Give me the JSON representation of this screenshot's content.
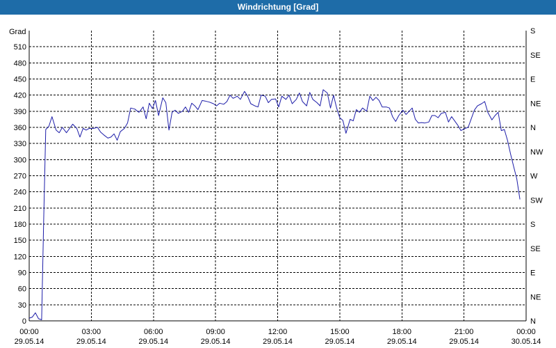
{
  "window": {
    "title": "Windrichtung [Grad]"
  },
  "chart_data": {
    "type": "line",
    "title": "Windrichtung [Grad]",
    "ylabel": "Grad",
    "xlabel": "",
    "ylim": [
      0,
      540
    ],
    "xlim": [
      0,
      24
    ],
    "grid": true,
    "x_unit": "hours since 29.05.14 00:00",
    "yticks": [
      0,
      30,
      60,
      90,
      120,
      150,
      180,
      210,
      240,
      270,
      300,
      330,
      360,
      390,
      420,
      450,
      480,
      510
    ],
    "right_ticks": [
      {
        "value": 0,
        "label": "N"
      },
      {
        "value": 45,
        "label": "NE"
      },
      {
        "value": 90,
        "label": "E"
      },
      {
        "value": 135,
        "label": "SE"
      },
      {
        "value": 180,
        "label": "S"
      },
      {
        "value": 225,
        "label": "SW"
      },
      {
        "value": 270,
        "label": "W"
      },
      {
        "value": 315,
        "label": "NW"
      },
      {
        "value": 360,
        "label": "N"
      },
      {
        "value": 405,
        "label": "NE"
      },
      {
        "value": 450,
        "label": "E"
      },
      {
        "value": 495,
        "label": "SE"
      },
      {
        "value": 540,
        "label": "S"
      }
    ],
    "xticks": [
      {
        "value": 0,
        "time": "00:00",
        "date": "29.05.14"
      },
      {
        "value": 3,
        "time": "03:00",
        "date": "29.05.14"
      },
      {
        "value": 6,
        "time": "06:00",
        "date": "29.05.14"
      },
      {
        "value": 9,
        "time": "09:00",
        "date": "29.05.14"
      },
      {
        "value": 12,
        "time": "12:00",
        "date": "29.05.14"
      },
      {
        "value": 15,
        "time": "15:00",
        "date": "29.05.14"
      },
      {
        "value": 18,
        "time": "18:00",
        "date": "29.05.14"
      },
      {
        "value": 21,
        "time": "21:00",
        "date": "29.05.14"
      },
      {
        "value": 24,
        "time": "00:00",
        "date": "30.05.14"
      }
    ],
    "line_color": "#1c1ca8",
    "grid_color": "#000000",
    "series": [
      {
        "name": "",
        "points": [
          [
            0.0,
            5
          ],
          [
            0.15,
            7
          ],
          [
            0.3,
            15
          ],
          [
            0.45,
            4
          ],
          [
            0.6,
            2
          ],
          [
            0.7,
            190
          ],
          [
            0.8,
            356
          ],
          [
            0.95,
            362
          ],
          [
            1.1,
            380
          ],
          [
            1.3,
            355
          ],
          [
            1.45,
            350
          ],
          [
            1.6,
            360
          ],
          [
            1.8,
            350
          ],
          [
            1.95,
            358
          ],
          [
            2.1,
            366
          ],
          [
            2.3,
            358
          ],
          [
            2.45,
            342
          ],
          [
            2.6,
            358
          ],
          [
            2.75,
            355
          ],
          [
            2.9,
            358
          ],
          [
            3.1,
            358
          ],
          [
            3.3,
            360
          ],
          [
            3.45,
            351
          ],
          [
            3.6,
            346
          ],
          [
            3.8,
            340
          ],
          [
            3.95,
            342
          ],
          [
            4.1,
            348
          ],
          [
            4.25,
            336
          ],
          [
            4.4,
            352
          ],
          [
            4.6,
            358
          ],
          [
            4.75,
            368
          ],
          [
            4.9,
            396
          ],
          [
            5.1,
            394
          ],
          [
            5.3,
            388
          ],
          [
            5.5,
            398
          ],
          [
            5.65,
            376
          ],
          [
            5.8,
            405
          ],
          [
            5.95,
            395
          ],
          [
            6.1,
            410
          ],
          [
            6.25,
            382
          ],
          [
            6.45,
            415
          ],
          [
            6.6,
            406
          ],
          [
            6.75,
            355
          ],
          [
            6.9,
            388
          ],
          [
            7.05,
            392
          ],
          [
            7.2,
            386
          ],
          [
            7.4,
            390
          ],
          [
            7.55,
            398
          ],
          [
            7.7,
            388
          ],
          [
            7.85,
            405
          ],
          [
            8.0,
            400
          ],
          [
            8.15,
            393
          ],
          [
            8.35,
            410
          ],
          [
            8.5,
            409
          ],
          [
            8.7,
            407
          ],
          [
            8.9,
            404
          ],
          [
            9.05,
            400
          ],
          [
            9.2,
            405
          ],
          [
            9.4,
            403
          ],
          [
            9.55,
            408
          ],
          [
            9.7,
            420
          ],
          [
            9.85,
            414
          ],
          [
            10.05,
            418
          ],
          [
            10.2,
            412
          ],
          [
            10.4,
            427
          ],
          [
            10.55,
            418
          ],
          [
            10.7,
            404
          ],
          [
            10.9,
            400
          ],
          [
            11.05,
            398
          ],
          [
            11.2,
            420
          ],
          [
            11.4,
            418
          ],
          [
            11.55,
            406
          ],
          [
            11.7,
            412
          ],
          [
            11.9,
            413
          ],
          [
            12.05,
            398
          ],
          [
            12.2,
            418
          ],
          [
            12.4,
            412
          ],
          [
            12.55,
            420
          ],
          [
            12.7,
            404
          ],
          [
            12.9,
            412
          ],
          [
            13.05,
            424
          ],
          [
            13.2,
            408
          ],
          [
            13.4,
            400
          ],
          [
            13.55,
            425
          ],
          [
            13.7,
            412
          ],
          [
            13.9,
            406
          ],
          [
            14.05,
            400
          ],
          [
            14.2,
            430
          ],
          [
            14.4,
            424
          ],
          [
            14.55,
            396
          ],
          [
            14.7,
            420
          ],
          [
            14.85,
            396
          ],
          [
            15.0,
            378
          ],
          [
            15.15,
            373
          ],
          [
            15.3,
            349
          ],
          [
            15.5,
            375
          ],
          [
            15.65,
            372
          ],
          [
            15.8,
            393
          ],
          [
            15.95,
            388
          ],
          [
            16.1,
            396
          ],
          [
            16.3,
            390
          ],
          [
            16.45,
            418
          ],
          [
            16.6,
            410
          ],
          [
            16.75,
            416
          ],
          [
            16.9,
            410
          ],
          [
            17.05,
            398
          ],
          [
            17.25,
            398
          ],
          [
            17.4,
            396
          ],
          [
            17.55,
            380
          ],
          [
            17.7,
            371
          ],
          [
            17.85,
            382
          ],
          [
            18.05,
            392
          ],
          [
            18.2,
            384
          ],
          [
            18.35,
            390
          ],
          [
            18.5,
            396
          ],
          [
            18.65,
            375
          ],
          [
            18.8,
            368
          ],
          [
            18.95,
            369
          ],
          [
            19.1,
            368
          ],
          [
            19.3,
            370
          ],
          [
            19.45,
            382
          ],
          [
            19.6,
            382
          ],
          [
            19.75,
            378
          ],
          [
            19.9,
            386
          ],
          [
            20.1,
            388
          ],
          [
            20.25,
            370
          ],
          [
            20.4,
            380
          ],
          [
            20.55,
            372
          ],
          [
            20.7,
            364
          ],
          [
            20.85,
            354
          ],
          [
            21.05,
            358
          ],
          [
            21.2,
            360
          ],
          [
            21.35,
            376
          ],
          [
            21.5,
            392
          ],
          [
            21.65,
            400
          ],
          [
            21.85,
            404
          ],
          [
            22.0,
            408
          ],
          [
            22.15,
            388
          ],
          [
            22.35,
            374
          ],
          [
            22.5,
            382
          ],
          [
            22.65,
            388
          ],
          [
            22.8,
            354
          ],
          [
            22.95,
            356
          ],
          [
            23.1,
            336
          ],
          [
            23.25,
            310
          ],
          [
            23.4,
            287
          ],
          [
            23.55,
            264
          ],
          [
            23.7,
            226
          ]
        ]
      }
    ]
  }
}
